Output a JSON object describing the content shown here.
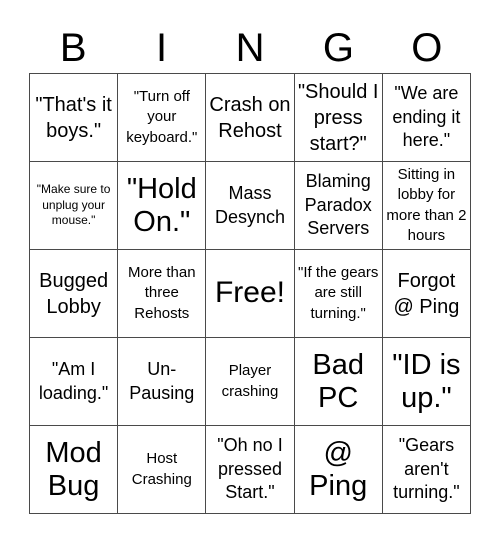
{
  "header": {
    "letters": [
      "B",
      "I",
      "N",
      "G",
      "O"
    ]
  },
  "card": {
    "cells": [
      [
        "\"That's it boys.\"",
        "\"Turn off your keyboard.\"",
        "Crash on Rehost",
        "\"Should I press start?\"",
        "\"We are ending it here.\""
      ],
      [
        "\"Make sure to unplug your mouse.\"",
        "\"Hold On.\"",
        "Mass Desynch",
        "Blaming Paradox Servers",
        "Sitting in lobby for more than 2 hours"
      ],
      [
        "Bugged Lobby",
        "More than three Rehosts",
        "Free!",
        "\"If the gears are still turning.\"",
        "Forgot @ Ping"
      ],
      [
        "\"Am I loading.\"",
        "Un-Pausing",
        "Player crashing",
        "Bad PC",
        "\"ID is up.\""
      ],
      [
        "Mod Bug",
        "Host Crashing",
        "\"Oh no I pressed Start.\"",
        "@ Ping",
        "\"Gears aren't turning.\""
      ]
    ]
  }
}
